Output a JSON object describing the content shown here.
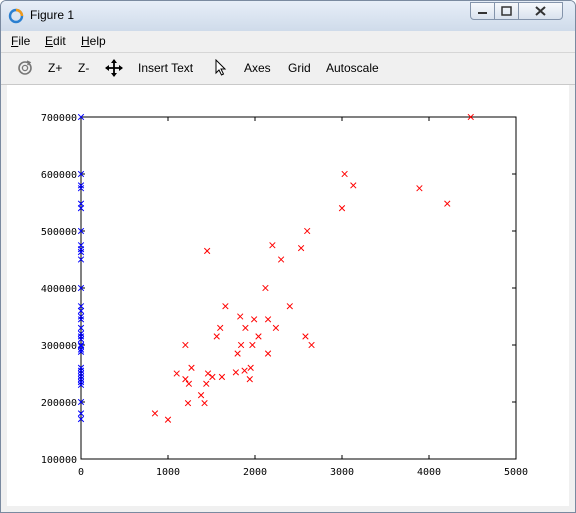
{
  "window": {
    "title": "Figure 1"
  },
  "menu": {
    "file": {
      "key": "F",
      "rest": "ile"
    },
    "edit": {
      "key": "E",
      "rest": "dit"
    },
    "help": {
      "key": "H",
      "rest": "elp"
    }
  },
  "toolbar": {
    "zoom_in": "Z+",
    "zoom_out": "Z-",
    "insert_text": "Insert Text",
    "axes": "Axes",
    "grid": "Grid",
    "autoscale": "Autoscale"
  },
  "colors": {
    "series_blue": "#0000ff",
    "series_red": "#ff0000"
  },
  "chart_data": {
    "type": "scatter",
    "xlim": [
      0,
      5000
    ],
    "ylim": [
      100000,
      700000
    ],
    "x_ticks": [
      "0",
      "1000",
      "2000",
      "3000",
      "4000",
      "5000"
    ],
    "y_ticks": [
      "100000",
      "200000",
      "300000",
      "400000",
      "500000",
      "600000",
      "700000"
    ],
    "marker": "x",
    "grid": false,
    "series": [
      {
        "color": "#0000ff",
        "points": [
          [
            0,
            700000
          ],
          [
            0,
            600000
          ],
          [
            0,
            580000
          ],
          [
            0,
            575000
          ],
          [
            0,
            548000
          ],
          [
            0,
            540000
          ],
          [
            0,
            500000
          ],
          [
            0,
            475000
          ],
          [
            0,
            468000
          ],
          [
            0,
            463000
          ],
          [
            0,
            450000
          ],
          [
            0,
            400000
          ],
          [
            0,
            368000
          ],
          [
            0,
            360000
          ],
          [
            0,
            350000
          ],
          [
            0,
            345000
          ],
          [
            0,
            330000
          ],
          [
            0,
            320000
          ],
          [
            0,
            315000
          ],
          [
            0,
            310000
          ],
          [
            0,
            300000
          ],
          [
            0,
            298000
          ],
          [
            0,
            292000
          ],
          [
            0,
            288000
          ],
          [
            0,
            260000
          ],
          [
            0,
            255000
          ],
          [
            0,
            250000
          ],
          [
            0,
            245000
          ],
          [
            0,
            240000
          ],
          [
            0,
            235000
          ],
          [
            0,
            230000
          ],
          [
            0,
            200000
          ],
          [
            0,
            180000
          ],
          [
            0,
            170000
          ]
        ]
      },
      {
        "color": "#ff0000",
        "points": [
          [
            4480,
            700000
          ],
          [
            3030,
            600000
          ],
          [
            3130,
            580000
          ],
          [
            3890,
            575000
          ],
          [
            4210,
            548000
          ],
          [
            3000,
            540000
          ],
          [
            2600,
            500000
          ],
          [
            2200,
            475000
          ],
          [
            1450,
            465000
          ],
          [
            2530,
            470000
          ],
          [
            2300,
            450000
          ],
          [
            2120,
            400000
          ],
          [
            2400,
            368000
          ],
          [
            1660,
            368000
          ],
          [
            1830,
            350000
          ],
          [
            2150,
            345000
          ],
          [
            1990,
            345000
          ],
          [
            1890,
            330000
          ],
          [
            1600,
            330000
          ],
          [
            2240,
            330000
          ],
          [
            2040,
            315000
          ],
          [
            1560,
            315000
          ],
          [
            2580,
            315000
          ],
          [
            2650,
            300000
          ],
          [
            1200,
            300000
          ],
          [
            1840,
            300000
          ],
          [
            1970,
            300000
          ],
          [
            1800,
            285000
          ],
          [
            2150,
            285000
          ],
          [
            1270,
            260000
          ],
          [
            1950,
            260000
          ],
          [
            1100,
            250000
          ],
          [
            1460,
            250000
          ],
          [
            1780,
            252000
          ],
          [
            1880,
            255000
          ],
          [
            1620,
            244000
          ],
          [
            1940,
            240000
          ],
          [
            1200,
            240000
          ],
          [
            1510,
            244000
          ],
          [
            1240,
            232000
          ],
          [
            1440,
            232000
          ],
          [
            1380,
            212000
          ],
          [
            1230,
            198000
          ],
          [
            1420,
            198000
          ],
          [
            850,
            180000
          ],
          [
            1000,
            169000
          ]
        ]
      }
    ]
  }
}
